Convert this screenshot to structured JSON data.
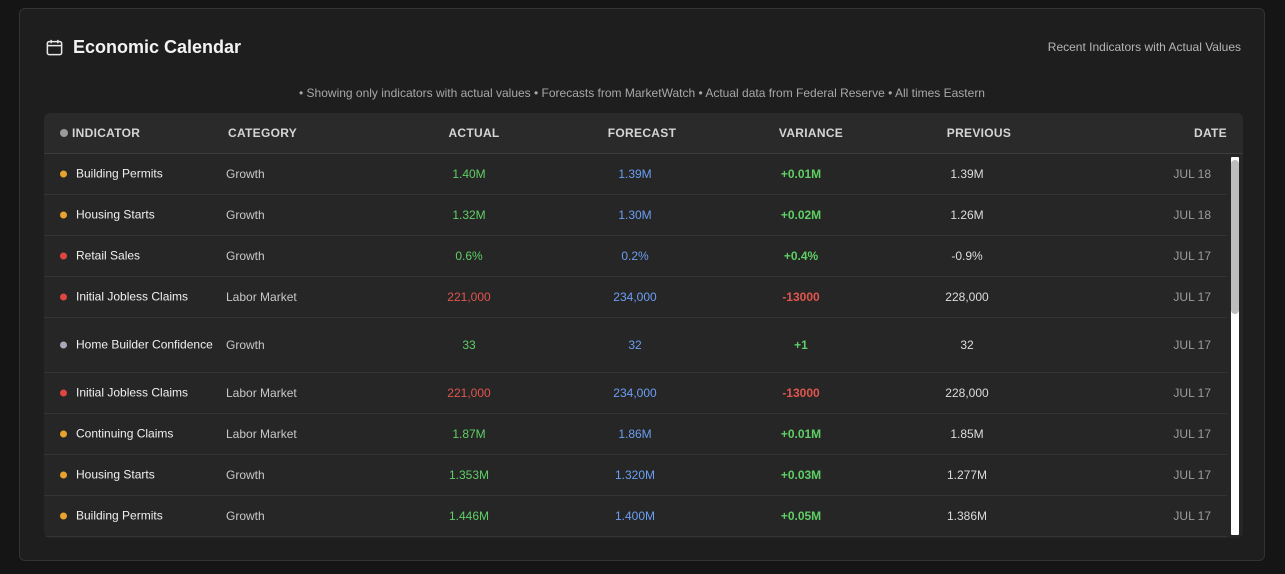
{
  "header": {
    "title": "Economic Calendar",
    "subtitle": "Recent Indicators with Actual Values",
    "note": "• Showing only indicators with actual values • Forecasts from MarketWatch • Actual data from Federal Reserve • All times Eastern"
  },
  "columns": {
    "indicator": "INDICATOR",
    "category": "CATEGORY",
    "actual": "ACTUAL",
    "forecast": "FORECAST",
    "variance": "VARIANCE",
    "previous": "PREVIOUS",
    "date": "DATE"
  },
  "colors": {
    "impact_medium": "#e8a22e",
    "impact_high": "#e0463f",
    "impact_low": "#a8a8b8",
    "positive": "#5fcf65",
    "negative": "#e0564e",
    "forecast": "#6b9ef2"
  },
  "rows": [
    {
      "indicator": "Building Permits",
      "category": "Growth",
      "actual": "1.40M",
      "forecast": "1.39M",
      "variance": "+0.01M",
      "previous": "1.39M",
      "date": "JUL 18",
      "impact": "impact_medium",
      "trend": "positive"
    },
    {
      "indicator": "Housing Starts",
      "category": "Growth",
      "actual": "1.32M",
      "forecast": "1.30M",
      "variance": "+0.02M",
      "previous": "1.26M",
      "date": "JUL 18",
      "impact": "impact_medium",
      "trend": "positive"
    },
    {
      "indicator": "Retail Sales",
      "category": "Growth",
      "actual": "0.6%",
      "forecast": "0.2%",
      "variance": "+0.4%",
      "previous": "-0.9%",
      "date": "JUL 17",
      "impact": "impact_high",
      "trend": "positive"
    },
    {
      "indicator": "Initial Jobless Claims",
      "category": "Labor Market",
      "actual": "221,000",
      "forecast": "234,000",
      "variance": "-13000",
      "previous": "228,000",
      "date": "JUL 17",
      "impact": "impact_high",
      "trend": "negative"
    },
    {
      "indicator": "Home Builder Confidence",
      "category": "Growth",
      "actual": "33",
      "forecast": "32",
      "variance": "+1",
      "previous": "32",
      "date": "JUL 17",
      "impact": "impact_low",
      "trend": "positive"
    },
    {
      "indicator": "Initial Jobless Claims",
      "category": "Labor Market",
      "actual": "221,000",
      "forecast": "234,000",
      "variance": "-13000",
      "previous": "228,000",
      "date": "JUL 17",
      "impact": "impact_high",
      "trend": "negative"
    },
    {
      "indicator": "Continuing Claims",
      "category": "Labor Market",
      "actual": "1.87M",
      "forecast": "1.86M",
      "variance": "+0.01M",
      "previous": "1.85M",
      "date": "JUL 17",
      "impact": "impact_medium",
      "trend": "positive"
    },
    {
      "indicator": "Housing Starts",
      "category": "Growth",
      "actual": "1.353M",
      "forecast": "1.320M",
      "variance": "+0.03M",
      "previous": "1.277M",
      "date": "JUL 17",
      "impact": "impact_medium",
      "trend": "positive"
    },
    {
      "indicator": "Building Permits",
      "category": "Growth",
      "actual": "1.446M",
      "forecast": "1.400M",
      "variance": "+0.05M",
      "previous": "1.386M",
      "date": "JUL 17",
      "impact": "impact_medium",
      "trend": "positive"
    }
  ]
}
